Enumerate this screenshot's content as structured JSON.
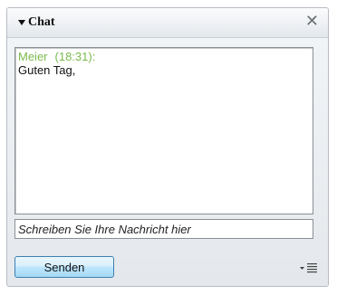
{
  "panel": {
    "title": "Chat",
    "collapse_icon": "triangle-down-icon",
    "close_icon": "close-icon",
    "close_glyph": "✕"
  },
  "chat": {
    "messages": [
      {
        "author": "Meier",
        "time": "(18:31):",
        "text": "Guten Tag,"
      }
    ],
    "author_color": "#7aba4c"
  },
  "input": {
    "placeholder": "Schreiben Sie Ihre Nachricht hier",
    "value": ""
  },
  "send_button": {
    "label": "Senden"
  },
  "options_icon": "menu-options-icon"
}
